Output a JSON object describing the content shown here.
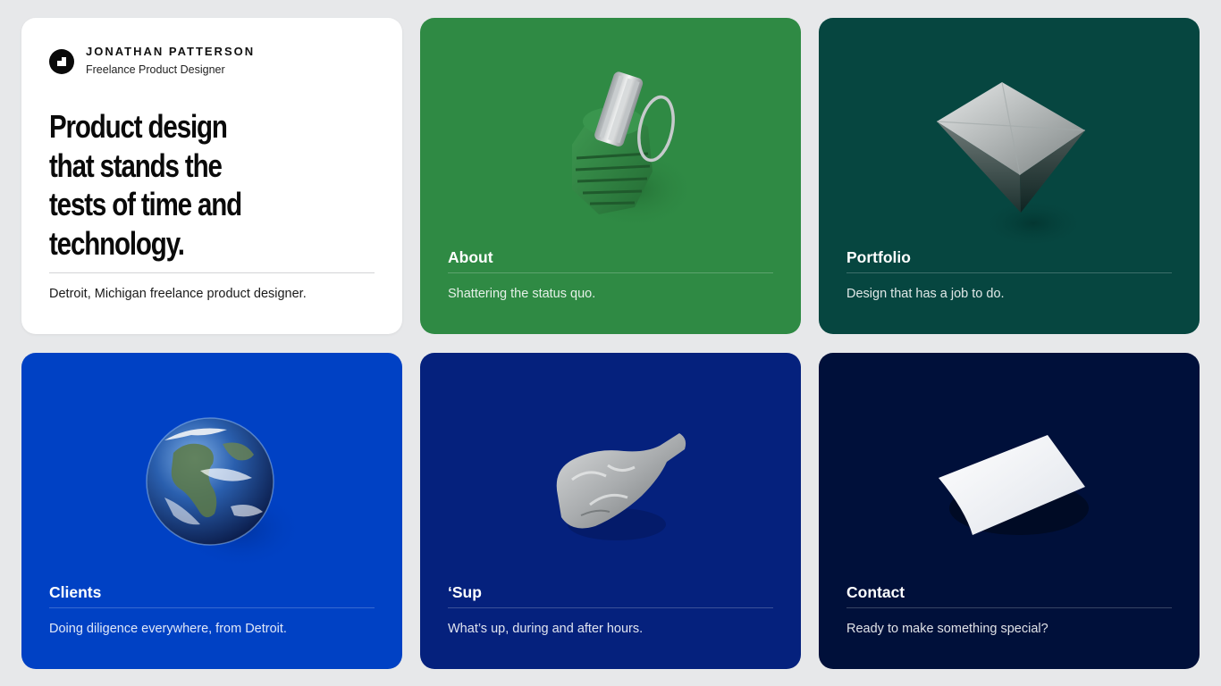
{
  "brand": {
    "name": "JONATHAN PATTERSON",
    "role": "Freelance Product Designer",
    "logo_icon": "brand-logo-icon"
  },
  "intro": {
    "headline": "Product design that stands the tests of time and technology.",
    "subtitle": "Detroit, Michigan freelance product designer."
  },
  "cards": [
    {
      "id": "about",
      "title": "About",
      "description": "Shattering the status quo.",
      "background": "#2f8a44",
      "illustration": "grenade-icon"
    },
    {
      "id": "portfolio",
      "title": "Portfolio",
      "description": "Design that has a job to do.",
      "background": "#064640",
      "illustration": "pyramid-icon"
    },
    {
      "id": "clients",
      "title": "Clients",
      "description": "Doing diligence everywhere, from Detroit.",
      "background": "#0041c4",
      "illustration": "globe-icon"
    },
    {
      "id": "sup",
      "title": "‘Sup",
      "description": "What’s up, during and after hours.",
      "background": "#05217d",
      "illustration": "balloon-icon"
    },
    {
      "id": "contact",
      "title": "Contact",
      "description": "Ready to make something special?",
      "background": "#00103a",
      "illustration": "paper-sheet-icon"
    }
  ],
  "colors": {
    "page_background": "#e7e8ea",
    "intro_card": "#ffffff"
  }
}
